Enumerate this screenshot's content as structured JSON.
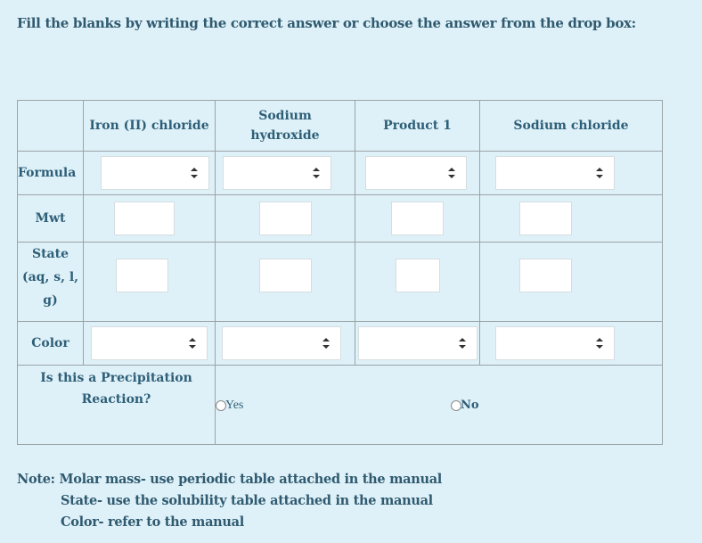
{
  "instructions": "Fill the blanks by writing the correct answer or choose the answer from the drop box:",
  "table": {
    "columns": [
      "",
      "Iron (II) chloride",
      "Sodium hydroxide",
      "Product 1",
      "Sodium chloride"
    ],
    "column_lines": {
      "sodium_hydroxide": [
        "Sodium",
        "hydroxide"
      ]
    },
    "rows": {
      "formula": {
        "label": "Formula",
        "input_type": "select",
        "values": [
          "",
          "",
          "",
          ""
        ]
      },
      "mwt": {
        "label": "Mwt",
        "input_type": "text",
        "values": [
          "",
          "",
          "",
          ""
        ]
      },
      "state": {
        "label_lines": [
          "State",
          "(aq, s, l,",
          "g)"
        ],
        "input_type": "text",
        "values": [
          "",
          "",
          "",
          ""
        ]
      },
      "color": {
        "label": "Color",
        "input_type": "select",
        "values": [
          "",
          "",
          "",
          ""
        ]
      }
    },
    "precipitation": {
      "label_lines": [
        "Is this a Precipitation",
        "Reaction?"
      ],
      "options": [
        {
          "label": "Yes",
          "selected": false
        },
        {
          "label": "No",
          "selected": false
        }
      ]
    }
  },
  "note": {
    "lines": [
      "Note: Molar mass- use periodic table attached in the manual",
      "State- use the solubility table attached in the manual",
      "Color- refer to the manual"
    ]
  }
}
